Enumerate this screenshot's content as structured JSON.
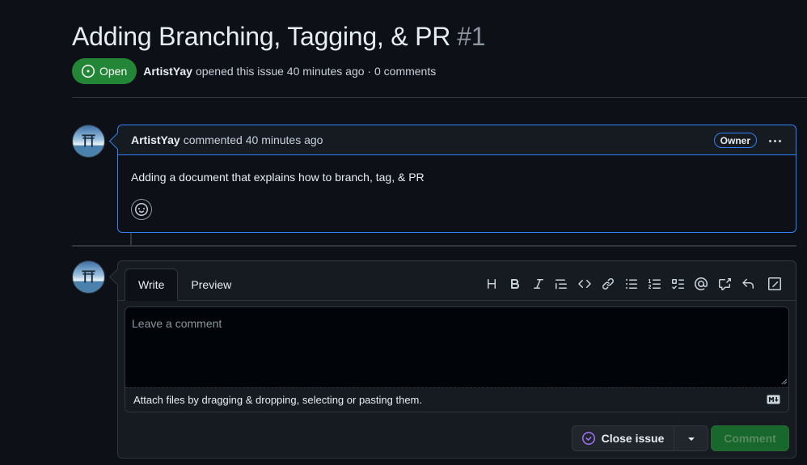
{
  "issue": {
    "title": "Adding Branching, Tagging, & PR",
    "number": "#1",
    "state": "Open",
    "author": "ArtistYay",
    "opened_text": "opened this issue 40 minutes ago · 0 comments"
  },
  "comment": {
    "author": "ArtistYay",
    "meta_text": "commented 40 minutes ago",
    "role_badge": "Owner",
    "body": "Adding a document that explains how to branch, tag, & PR",
    "reaction_icon": "smiley-icon"
  },
  "editor": {
    "tabs": [
      {
        "label": "Write",
        "active": true
      },
      {
        "label": "Preview",
        "active": false
      }
    ],
    "toolbar": [
      "heading-icon",
      "bold-icon",
      "italic-icon",
      "quote-icon",
      "code-icon",
      "link-icon",
      "unordered-list-icon",
      "ordered-list-icon",
      "task-list-icon",
      "mention-icon",
      "cross-reference-icon",
      "reply-icon",
      "slash-command-icon"
    ],
    "placeholder": "Leave a comment",
    "attach_text": "Attach files by dragging & dropping, selecting or pasting them.",
    "markdown_icon": "markdown-icon"
  },
  "actions": {
    "close_issue_label": "Close issue",
    "comment_label": "Comment"
  },
  "colors": {
    "background": "#0d1117",
    "open_badge": "#238636",
    "accent_border": "#2f81f7",
    "close_icon": "#a371f7",
    "comment_button": "#196c2e"
  }
}
